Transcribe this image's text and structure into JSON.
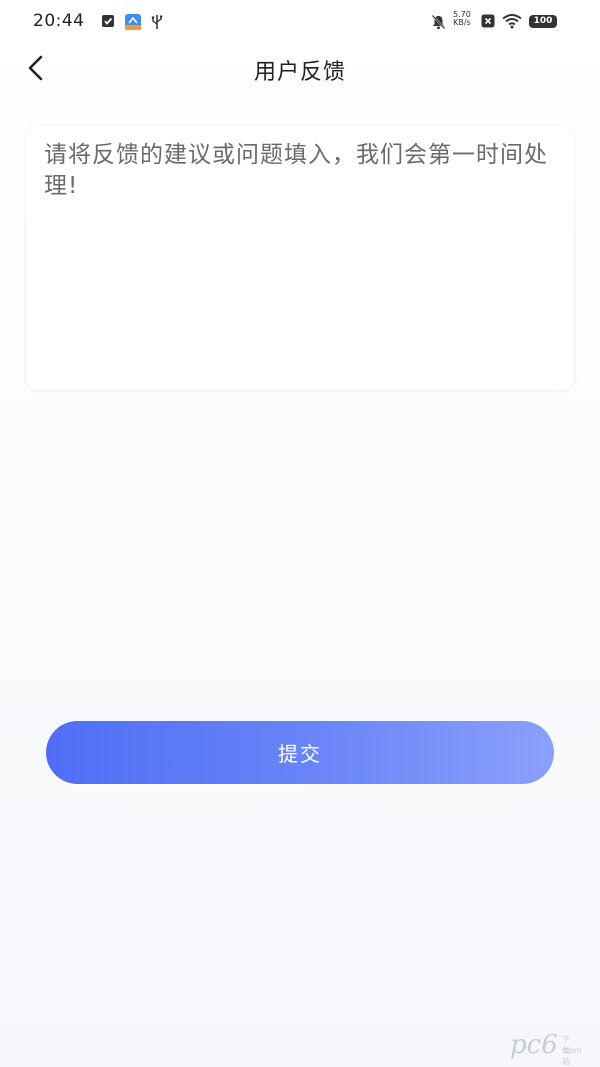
{
  "status_bar": {
    "time": "20:44",
    "net_speed_value": "5.70",
    "net_speed_unit": "KB/s",
    "battery": "100"
  },
  "header": {
    "title": "用户反馈"
  },
  "feedback": {
    "value": "",
    "placeholder": "请将反馈的建议或问题填入，我们会第一时间处理!"
  },
  "submit": {
    "label": "提交"
  },
  "watermark": {
    "text": "pc6",
    "sub": "下载站",
    "sub2": ".com"
  },
  "colors": {
    "accent_start": "#4f6ef5",
    "accent_end": "#8aa0fb"
  }
}
